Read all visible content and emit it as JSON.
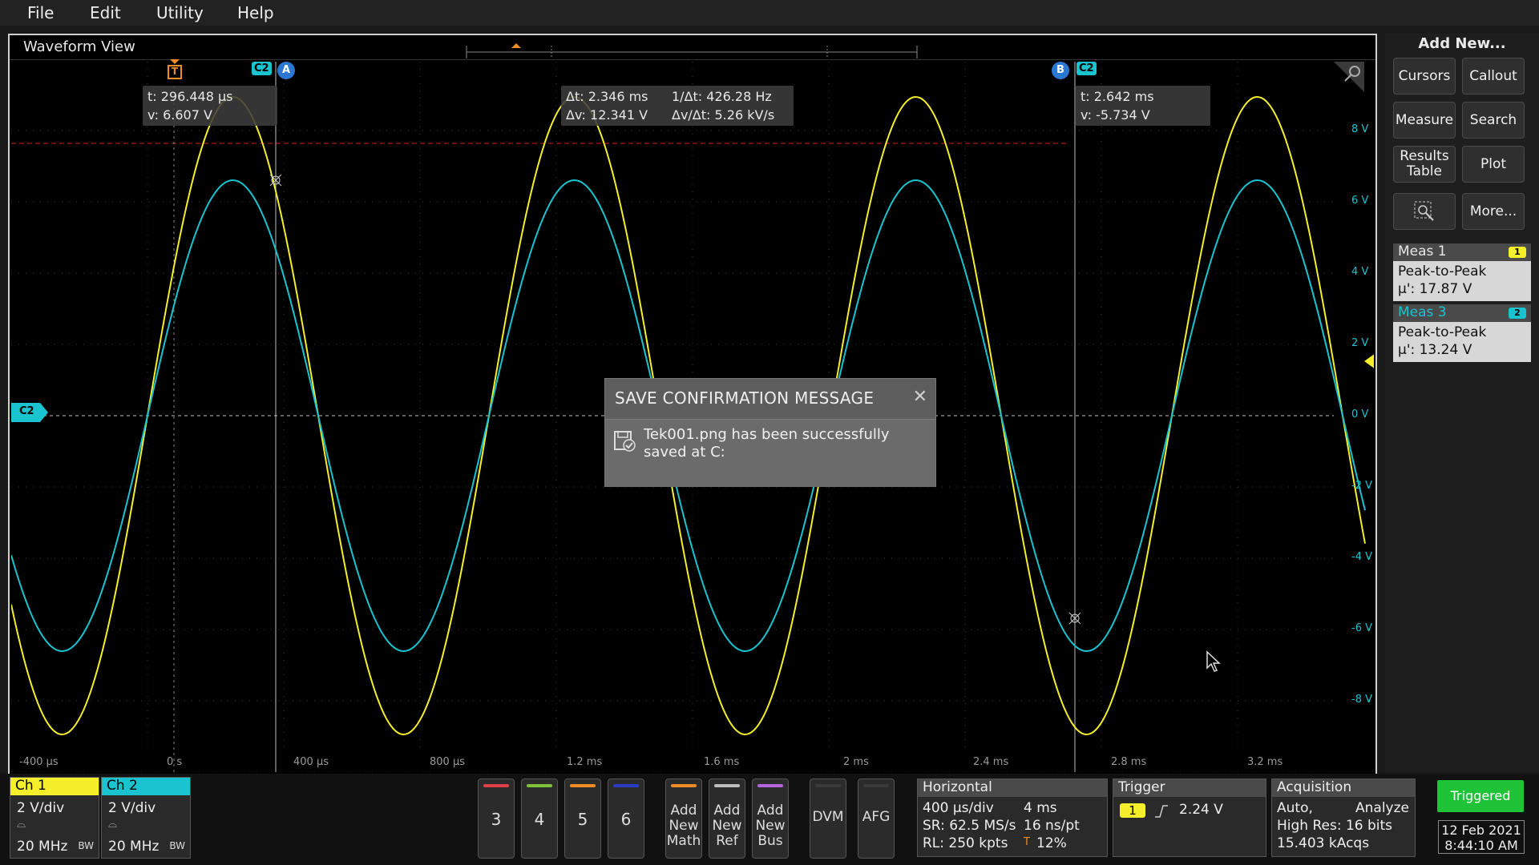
{
  "menu": {
    "file": "File",
    "edit": "Edit",
    "utility": "Utility",
    "help": "Help"
  },
  "waveform_view": {
    "title": "Waveform View",
    "x_ticks": [
      "-400 µs",
      "0 s",
      "400 µs",
      "800 µs",
      "1.2 ms",
      "1.6 ms",
      "2 ms",
      "2.4 ms",
      "2.8 ms",
      "3.2 ms"
    ],
    "y_ticks": [
      "8 V",
      "6 V",
      "4 V",
      "2 V",
      "0 V",
      "-2 V",
      "-4 V",
      "-6 V",
      "-8 V"
    ],
    "channel_marker": "C2",
    "trigger_marker": "T",
    "cursor_a": {
      "label": "A",
      "channel": "C2",
      "t": "t: 296.448 µs",
      "v": "v: 6.607 V"
    },
    "cursor_b": {
      "label": "B",
      "channel": "C2",
      "t": "t: 2.642 ms",
      "v": "v: -5.734 V"
    },
    "delta": {
      "dt": "Δt: 2.346 ms",
      "inv_dt": "1/Δt: 426.28 Hz",
      "dv": "Δv: 12.341 V",
      "dvdt": "Δv/Δt: 5.26 kV/s"
    },
    "colors": {
      "ch1": "#f5ee2a",
      "ch2": "#19c4d0",
      "cursor_ref": "#d41c1c"
    }
  },
  "dialog": {
    "title": "SAVE CONFIRMATION MESSAGE",
    "message": "Tek001.png has been successfully saved at C:",
    "close_icon": "close-icon"
  },
  "sidebar": {
    "add_new": "Add New...",
    "buttons": {
      "cursors": "Cursors",
      "callout": "Callout",
      "measure": "Measure",
      "search": "Search",
      "results_table": "Results Table",
      "plot": "Plot",
      "more": "More..."
    },
    "meas1": {
      "title": "Meas 1",
      "tag": "1",
      "type": "Peak-to-Peak",
      "value": "µ': 17.87 V"
    },
    "meas3": {
      "title": "Meas 3",
      "tag": "2",
      "type": "Peak-to-Peak",
      "value": "µ': 13.24 V"
    }
  },
  "bottom": {
    "ch1": {
      "label": "Ch 1",
      "scale": "2 V/div",
      "bw": "20 MHz",
      "bw_tag": "BW"
    },
    "ch2": {
      "label": "Ch 2",
      "scale": "2 V/div",
      "bw": "20 MHz",
      "bw_tag": "BW"
    },
    "channel_buttons": [
      "3",
      "4",
      "5",
      "6"
    ],
    "add_math": "Add New Math",
    "add_ref": "Add New Ref",
    "add_bus": "Add New Bus",
    "dvm": "DVM",
    "afg": "AFG",
    "horizontal": {
      "title": "Horizontal",
      "scale": "400 µs/div",
      "length": "4 ms",
      "sr": "SR: 62.5 MS/s",
      "pt": "16 ns/pt",
      "rl": "RL: 250 kpts",
      "pos": "12%"
    },
    "trigger": {
      "title": "Trigger",
      "source": "1",
      "level": "2.24 V"
    },
    "acquisition": {
      "title": "Acquisition",
      "mode": "Auto,",
      "analyze": "Analyze",
      "res": "High Res: 16 bits",
      "acqs": "15.403 kAcqs"
    },
    "status": "Triggered",
    "date": "12 Feb 2021",
    "time": "8:44:10 AM"
  }
}
